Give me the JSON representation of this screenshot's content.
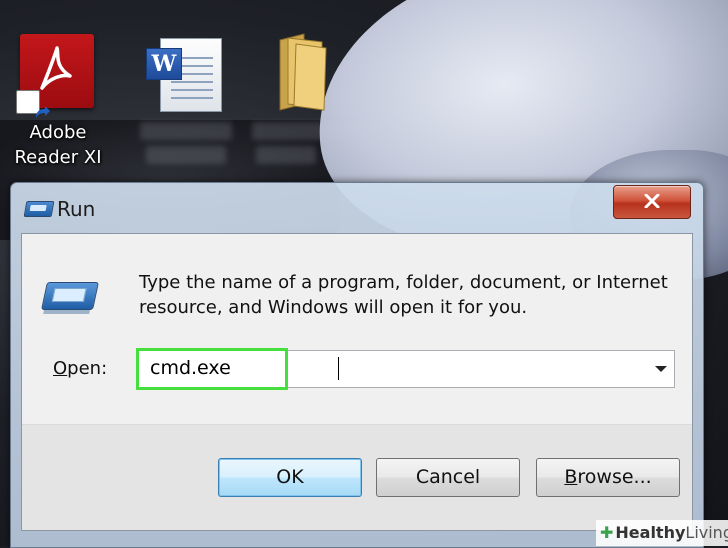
{
  "desktop": {
    "icons": [
      {
        "label_line1": "Adobe",
        "label_line2": "Reader XI"
      }
    ]
  },
  "dialog": {
    "title": "Run",
    "description": "Type the name of a program, folder, document, or Internet resource, and Windows will open it for you.",
    "open_label_accel": "O",
    "open_label_rest": "pen:",
    "open_value": "cmd.exe",
    "buttons": {
      "ok": "OK",
      "cancel": "Cancel",
      "browse_accel": "B",
      "browse_rest": "rowse..."
    }
  },
  "watermark": {
    "healthy": "Healthy",
    "living": "Living"
  },
  "colors": {
    "highlight": "#46e03e",
    "close_button": "#c9452d",
    "ok_border": "#3c7fb1"
  }
}
